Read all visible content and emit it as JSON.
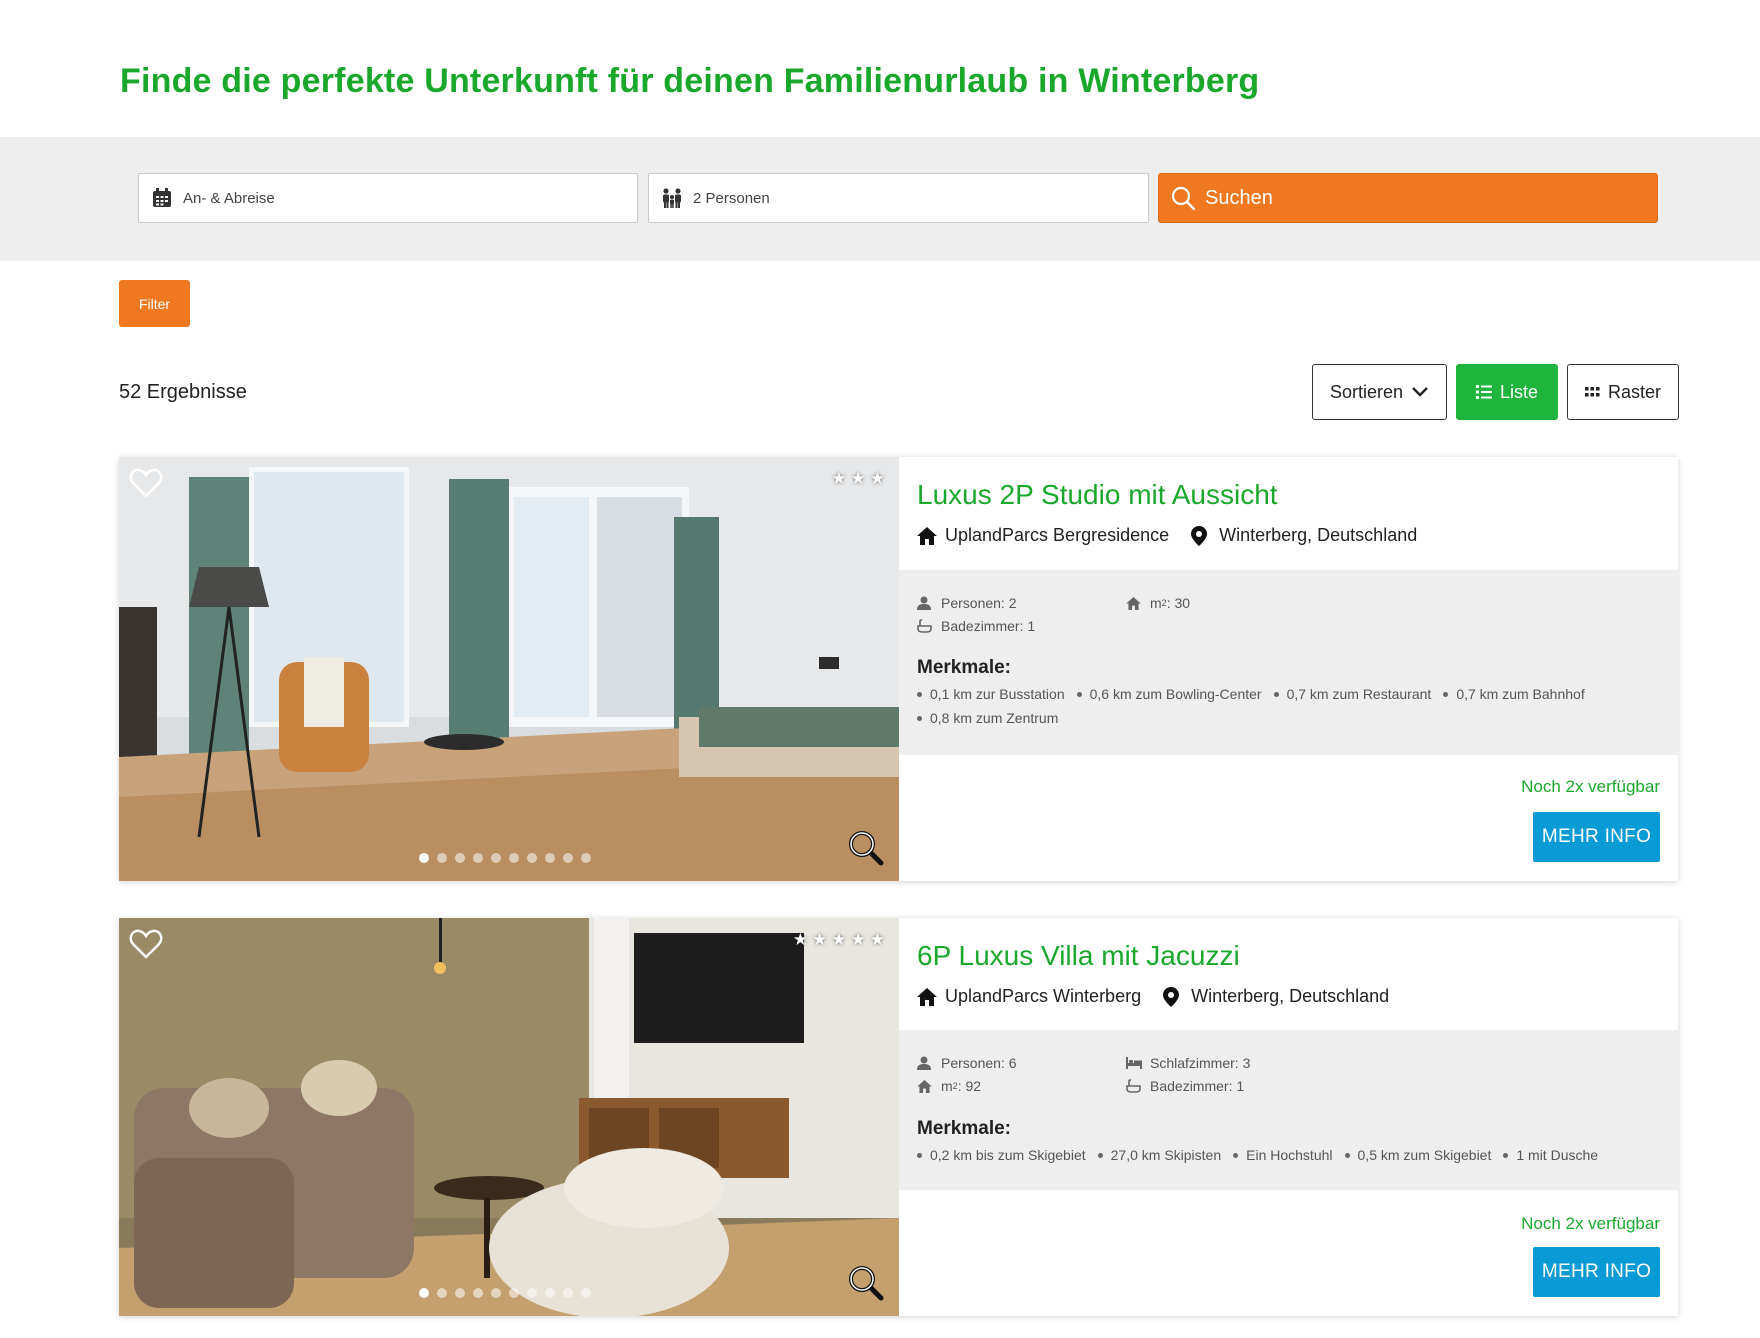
{
  "headline": "Finde die perfekte Unterkunft für deinen Familienurlaub in Winterberg",
  "search": {
    "dates_placeholder": "An- & Abreise",
    "guests_value": "2 Personen",
    "button_label": "Suchen"
  },
  "filter_label": "Filter",
  "results_label": "52 Ergebnisse",
  "view_controls": {
    "sort_label": "Sortieren",
    "list_label": "Liste",
    "grid_label": "Raster"
  },
  "listings": [
    {
      "title": "Luxus 2P Studio mit Aussicht",
      "park": "UplandParcs Bergresidence",
      "location": "Winterberg, Deutschland",
      "stars": 3,
      "photo_count": 10,
      "attributes": {
        "persons": "Personen: 2",
        "bathrooms": "Badezimmer: 1",
        "area_prefix": "m",
        "area_value": ": 30"
      },
      "features_title": "Merkmale:",
      "features": [
        "0,1 km zur Busstation",
        "0,6 km zum Bowling-Center",
        "0,7 km zum Restaurant",
        "0,7 km zum Bahnhof",
        "0,8 km zum Zentrum"
      ],
      "availability": "Noch 2x verfügbar",
      "more_label": "MEHR INFO"
    },
    {
      "title": "6P Luxus Villa mit Jacuzzi",
      "park": "UplandParcs Winterberg",
      "location": "Winterberg, Deutschland",
      "stars": 5,
      "photo_count": 10,
      "attributes": {
        "persons": "Personen: 6",
        "bedrooms": "Schlafzimmer: 3",
        "area_prefix": "m",
        "area_value": ": 92",
        "bathrooms": "Badezimmer: 1"
      },
      "features_title": "Merkmale:",
      "features": [
        "0,2 km bis zum Skigebiet",
        "27,0 km Skipisten",
        "Ein Hochstuhl",
        "0,5 km zum Skigebiet",
        "1 mit Dusche"
      ],
      "availability": "Noch 2x verfügbar",
      "more_label": "MEHR INFO"
    }
  ],
  "colors": {
    "brand_green": "#1aa82c",
    "accent_orange": "#f07820",
    "info_blue": "#0a9bd6"
  }
}
